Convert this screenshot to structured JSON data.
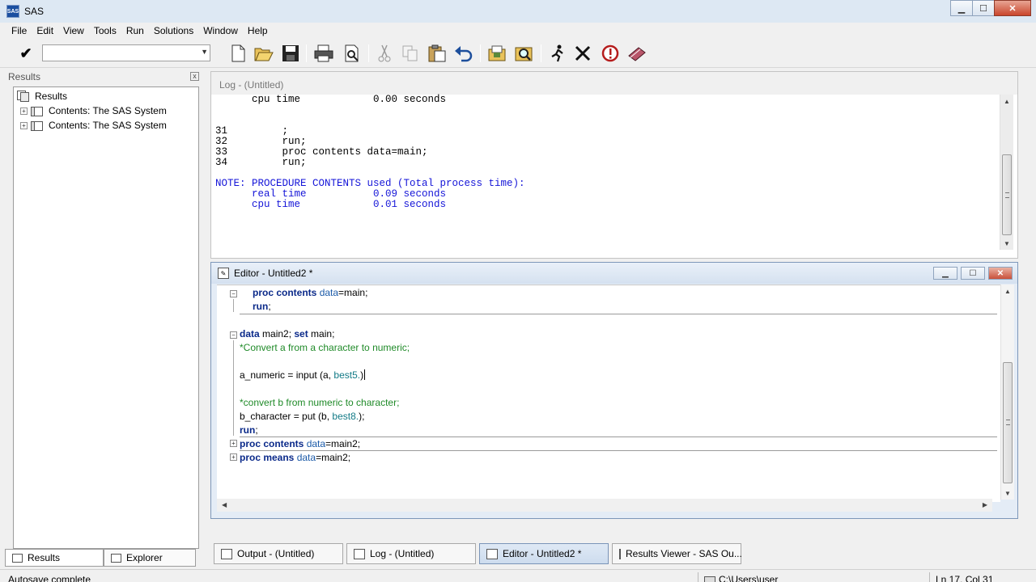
{
  "window": {
    "title": "SAS",
    "app_icon": "sas",
    "controls": {
      "minimize": "▁",
      "maximize": "☐",
      "close": "✕"
    }
  },
  "menu": [
    "File",
    "Edit",
    "View",
    "Tools",
    "Run",
    "Solutions",
    "Window",
    "Help"
  ],
  "toolbar": {
    "check_glyph": "✔",
    "command_value": "",
    "icons": [
      "new-icon",
      "open-icon",
      "save-icon",
      "print-icon",
      "print-preview-icon",
      "cut-icon",
      "copy-icon",
      "paste-icon",
      "undo-icon",
      "libraries-icon",
      "explorer-icon",
      "submit-run-icon",
      "clear-icon",
      "help-icon",
      "sas-docs-icon"
    ]
  },
  "results": {
    "header": "Results",
    "close_glyph": "x",
    "tree": [
      {
        "label": "Results",
        "icon": "results-icon"
      },
      {
        "label": "Contents:  The SAS System",
        "icon": "folder-pages-icon"
      },
      {
        "label": "Contents:  The SAS System",
        "icon": "folder-pages-icon"
      }
    ],
    "tabs": [
      "Results",
      "Explorer"
    ]
  },
  "log": {
    "title": "Log - (Untitled)",
    "lines": [
      "      cpu time            0.00 seconds",
      "",
      "",
      "31         ;",
      "32         run;",
      "33         proc contents data=main;",
      "34         run;",
      "",
      "NOTE: PROCEDURE CONTENTS used (Total process time):",
      "      real time           0.09 seconds",
      "      cpu time            0.01 seconds"
    ]
  },
  "editor": {
    "title": "Editor - Untitled2 *",
    "code": {
      "l1": {
        "kw": "proc contents",
        "opt": "data",
        "rest": "=main;"
      },
      "l2": {
        "kw": "run",
        "rest": ";"
      },
      "l3": {
        "kw": "data",
        "rest1": " main2; ",
        "kw2": "set",
        "rest2": " main;"
      },
      "l4": {
        "cmt": "*Convert a from a character to numeric;"
      },
      "l5": {
        "pre": "a_numeric = input (a, ",
        "fmt": "best5.",
        "post": ")"
      },
      "l6": {
        "cmt": "*convert b from numeric to character;"
      },
      "l7": {
        "pre": "b_character = put (b, ",
        "fmt": "best8.",
        "post": ");"
      },
      "l8": {
        "kw": "run",
        "rest": ";"
      },
      "l9": {
        "kw": "proc contents",
        "opt": "data",
        "rest": "=main2;"
      },
      "l10": {
        "kw": "proc means",
        "opt": "data",
        "rest": "=main2;"
      }
    }
  },
  "taskbar": [
    {
      "label": "Output - (Untitled)",
      "active": false
    },
    {
      "label": "Log - (Untitled)",
      "active": false
    },
    {
      "label": "Editor - Untitled2 *",
      "active": true
    },
    {
      "label": "Results Viewer - SAS Ou...",
      "active": false
    }
  ],
  "status": {
    "message": "Autosave complete",
    "path": "C:\\Users\\user",
    "position": "Ln 17, Col 31"
  }
}
